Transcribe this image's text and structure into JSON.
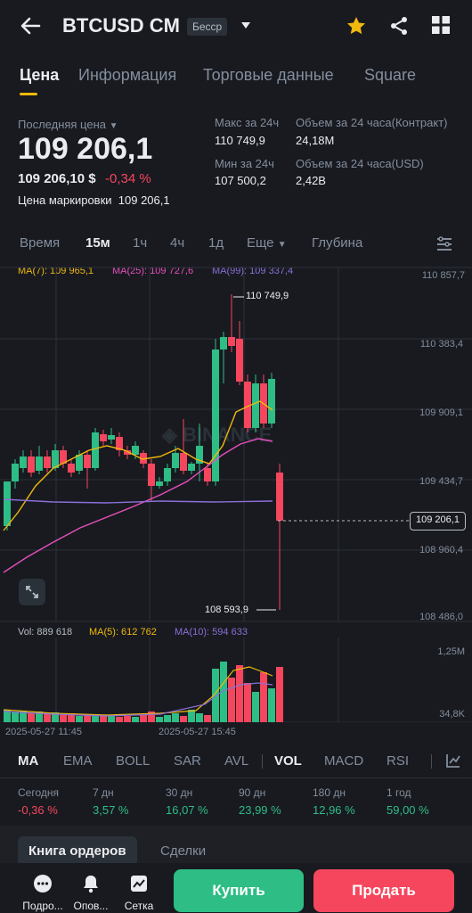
{
  "header": {
    "title": "BTCUSD CM",
    "badge": "Бесср"
  },
  "tabs": [
    "Цена",
    "Информация",
    "Торговые данные",
    "Square"
  ],
  "price": {
    "last_label": "Последняя цена",
    "last": "109 206,1",
    "sub_price": "109 206,10 $",
    "change": "-0,34 %",
    "mark_label": "Цена маркировки",
    "mark": "109 206,1"
  },
  "stats": {
    "high_label": "Макс за 24ч",
    "high": "110 749,9",
    "low_label": "Мин за 24ч",
    "low": "107 500,2",
    "vol_contract_label": "Объем за 24 часа(Контракт)",
    "vol_contract": "24,18M",
    "vol_usd_label": "Объем за 24 часа(USD)",
    "vol_usd": "2,42B"
  },
  "timeframes": [
    "Время",
    "15м",
    "1ч",
    "4ч",
    "1д",
    "Еще",
    "Глубина"
  ],
  "ma": {
    "ma7": "MA(7): 109 965,1",
    "ma25": "MA(25): 109 727,6",
    "ma99": "MA(99): 109 337,4"
  },
  "price_axis": [
    "110 857,7",
    "110 383,4",
    "109 909,1",
    "109 434,7",
    "108 960,4",
    "108 486,0"
  ],
  "current_price_tag": "109 206,1",
  "high_marker": "110 749,9",
  "low_marker": "108 593,9",
  "volume": {
    "vol": "Vol: 889 618",
    "ma5": "MA(5): 612 762",
    "ma10": "MA(10): 594 633",
    "axis_top": "1,25M",
    "axis_bottom": "34,8K"
  },
  "time_axis": [
    "2025-05-27 11:45",
    "2025-05-27 15:45"
  ],
  "indicators": [
    "MA",
    "EMA",
    "BOLL",
    "SAR",
    "AVL",
    "VOL",
    "MACD",
    "RSI"
  ],
  "performance": [
    {
      "label": "Сегодня",
      "value": "-0,36 %"
    },
    {
      "label": "7 дн",
      "value": "3,57 %"
    },
    {
      "label": "30 дн",
      "value": "16,07 %"
    },
    {
      "label": "90 дн",
      "value": "23,99 %"
    },
    {
      "label": "180 дн",
      "value": "12,96 %"
    },
    {
      "label": "1 год",
      "value": "59,00 %"
    }
  ],
  "book_tabs": [
    "Книга ордеров",
    "Сделки"
  ],
  "bottom_nav": [
    "Подро...",
    "Опов...",
    "Сетка"
  ],
  "buy_label": "Купить",
  "sell_label": "Продать",
  "colors": {
    "bg": "#181a20",
    "green": "#2ebd85",
    "red": "#f6465d",
    "accent": "#f0b90b",
    "ma7": "#f0b90b",
    "ma25": "#e84fbd",
    "ma99": "#8b6fd6"
  },
  "chart_data": {
    "type": "candlestick",
    "interval": "15m",
    "ylim": [
      108486.0,
      110857.7
    ],
    "high": 110749.9,
    "low": 108593.9,
    "last": 109206.1
  }
}
